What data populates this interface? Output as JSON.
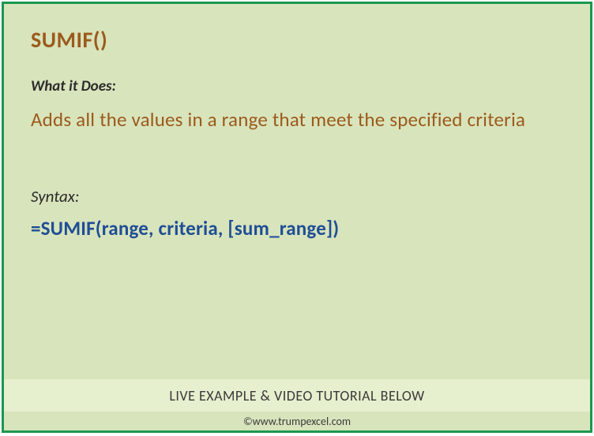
{
  "title": "SUMIF()",
  "whatItDoes": {
    "label": "What it Does:",
    "description": "Adds all the values in a range that meet the specified criteria"
  },
  "syntax": {
    "label": "Syntax:",
    "formula": "=SUMIF(range, criteria, [sum_range])"
  },
  "footer": {
    "banner": "LIVE EXAMPLE & VIDEO TUTORIAL BELOW",
    "copyright": "©www.trumpexcel.com"
  }
}
